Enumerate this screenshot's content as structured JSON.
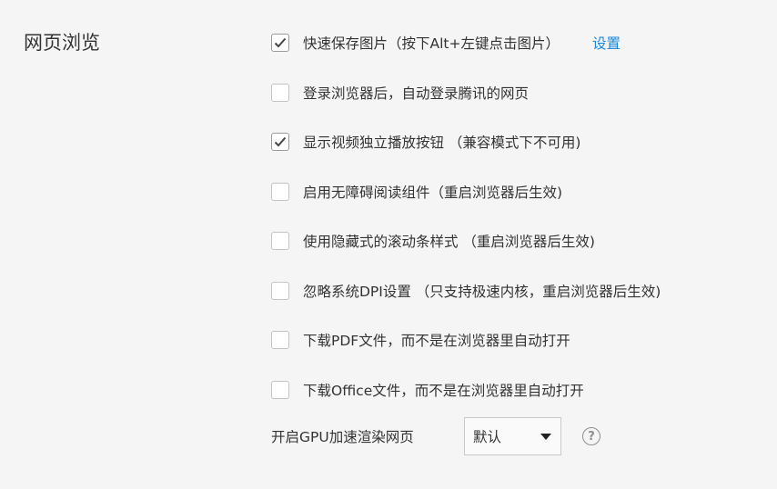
{
  "section": {
    "title": "网页浏览"
  },
  "options": [
    {
      "label": "快速保存图片（按下Alt+左键点击图片）",
      "checked": true,
      "link": "设置"
    },
    {
      "label": "登录浏览器后，自动登录腾讯的网页",
      "checked": false
    },
    {
      "label": "显示视频独立播放按钮 （兼容模式下不可用)",
      "checked": true
    },
    {
      "label": "启用无障碍阅读组件（重启浏览器后生效)",
      "checked": false
    },
    {
      "label": "使用隐藏式的滚动条样式 （重启浏览器后生效)",
      "checked": false
    },
    {
      "label": "忽略系统DPI设置 （只支持极速内核，重启浏览器后生效)",
      "checked": false
    },
    {
      "label": "下载PDF文件，而不是在浏览器里自动打开",
      "checked": false
    },
    {
      "label": "下载Office文件，而不是在浏览器里自动打开",
      "checked": false
    }
  ],
  "gpu": {
    "label": "开启GPU加速渲染网页",
    "selected": "默认",
    "help_glyph": "?"
  },
  "icons": {
    "checkbox_tick": "check-icon",
    "dropdown": "caret-down-icon",
    "help": "question-circle-icon"
  },
  "colors": {
    "background": "#f5f5f5",
    "text": "#333333",
    "link": "#1c86d8",
    "checkbox_border": "#c4c4c4"
  }
}
